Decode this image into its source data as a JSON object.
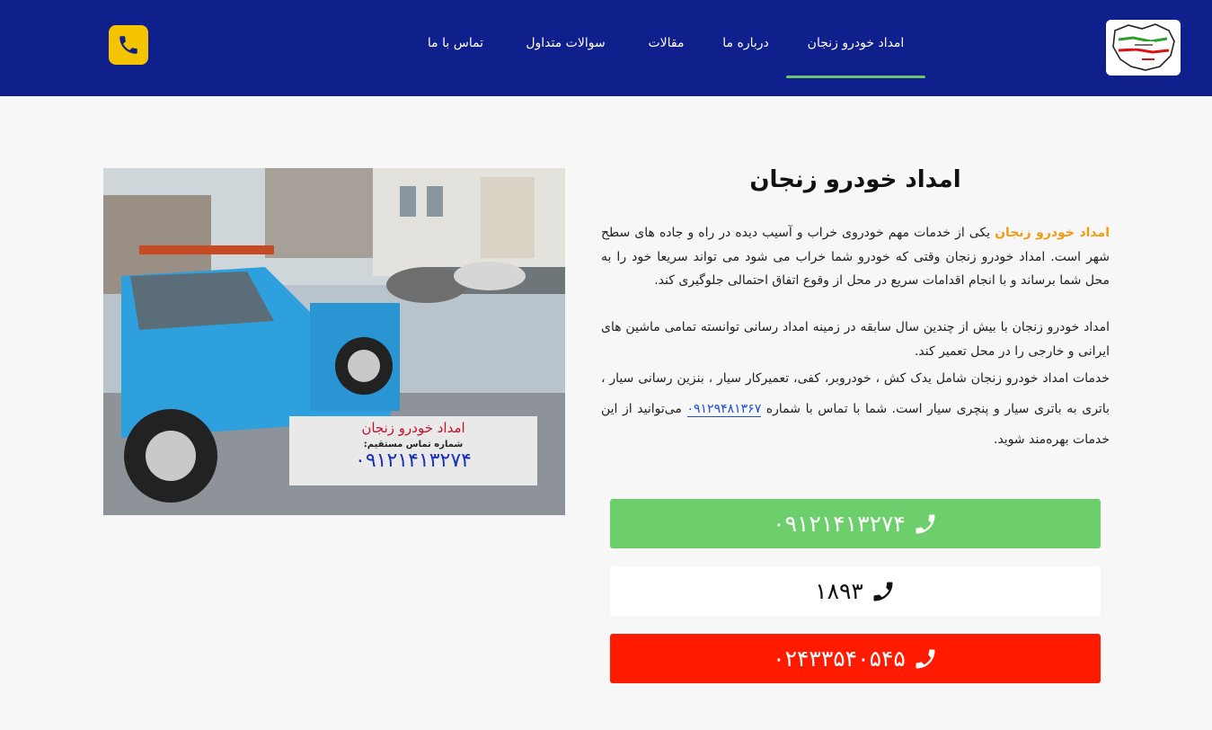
{
  "header": {
    "nav": [
      {
        "label": "امداد خودرو زنجان",
        "active": true
      },
      {
        "label": "درباره ما"
      },
      {
        "label": "مقالات"
      },
      {
        "label": "سوالات متداول"
      },
      {
        "label": "تماس با ما"
      }
    ],
    "call_icon": "phone-icon",
    "colors": {
      "bg": "#0f1f8c",
      "accent": "#6cc56c",
      "call_button": "#f5c400"
    }
  },
  "hero_image": {
    "sign_title": "امداد خودرو زنجان",
    "sign_subtitle": "شماره تماس مستقیم:",
    "sign_phone": "۰۹۱۲۱۴۱۳۲۷۴"
  },
  "content": {
    "title": "امداد خودرو زنجان",
    "p1_highlight": "امداد خودرو زنجان",
    "p1_rest": " یکی از خدمات مهم خودروی خراب و آسیب دیده در راه و جاده های سطح شهر است. امداد خودرو زنجان وقتی که خودرو شما خراب می شود می تواند سریعا خود را به محل شما برساند و با انجام اقدامات سریع در محل از وقوع اتفاق احتمالی جلوگیری کند.",
    "p2": "امداد خودرو زنجان با بیش از چندین سال سابقه در زمینه امداد رسانی توانسته تمامی ماشین های ایرانی و خارجی را در محل تعمیر کند.",
    "p3_before": "خدمات امداد خودرو زنجان شامل یدک کش ، خودروبر، کفی، تعمیرکار سیار ، بنزین رسانی سیار ، باتری به باتری سیار و پنچری سیار است. شما با تماس با شماره ",
    "p3_link": "۰۹۱۲۹۴۸۱۳۶۷",
    "p3_after": " می‌توانید از این خدمات بهره‌مند شوید."
  },
  "phone_buttons": [
    {
      "number": "۰۹۱۲۱۴۱۳۲۷۴",
      "icon": "phone-icon",
      "color": "#6ccf6c"
    },
    {
      "number": "۱۸۹۳",
      "icon": "phone-icon",
      "color": "#ffffff"
    },
    {
      "number": "۰۲۴۳۳۵۴۰۵۴۵",
      "icon": "phone-icon",
      "color": "#ff1a00"
    }
  ]
}
